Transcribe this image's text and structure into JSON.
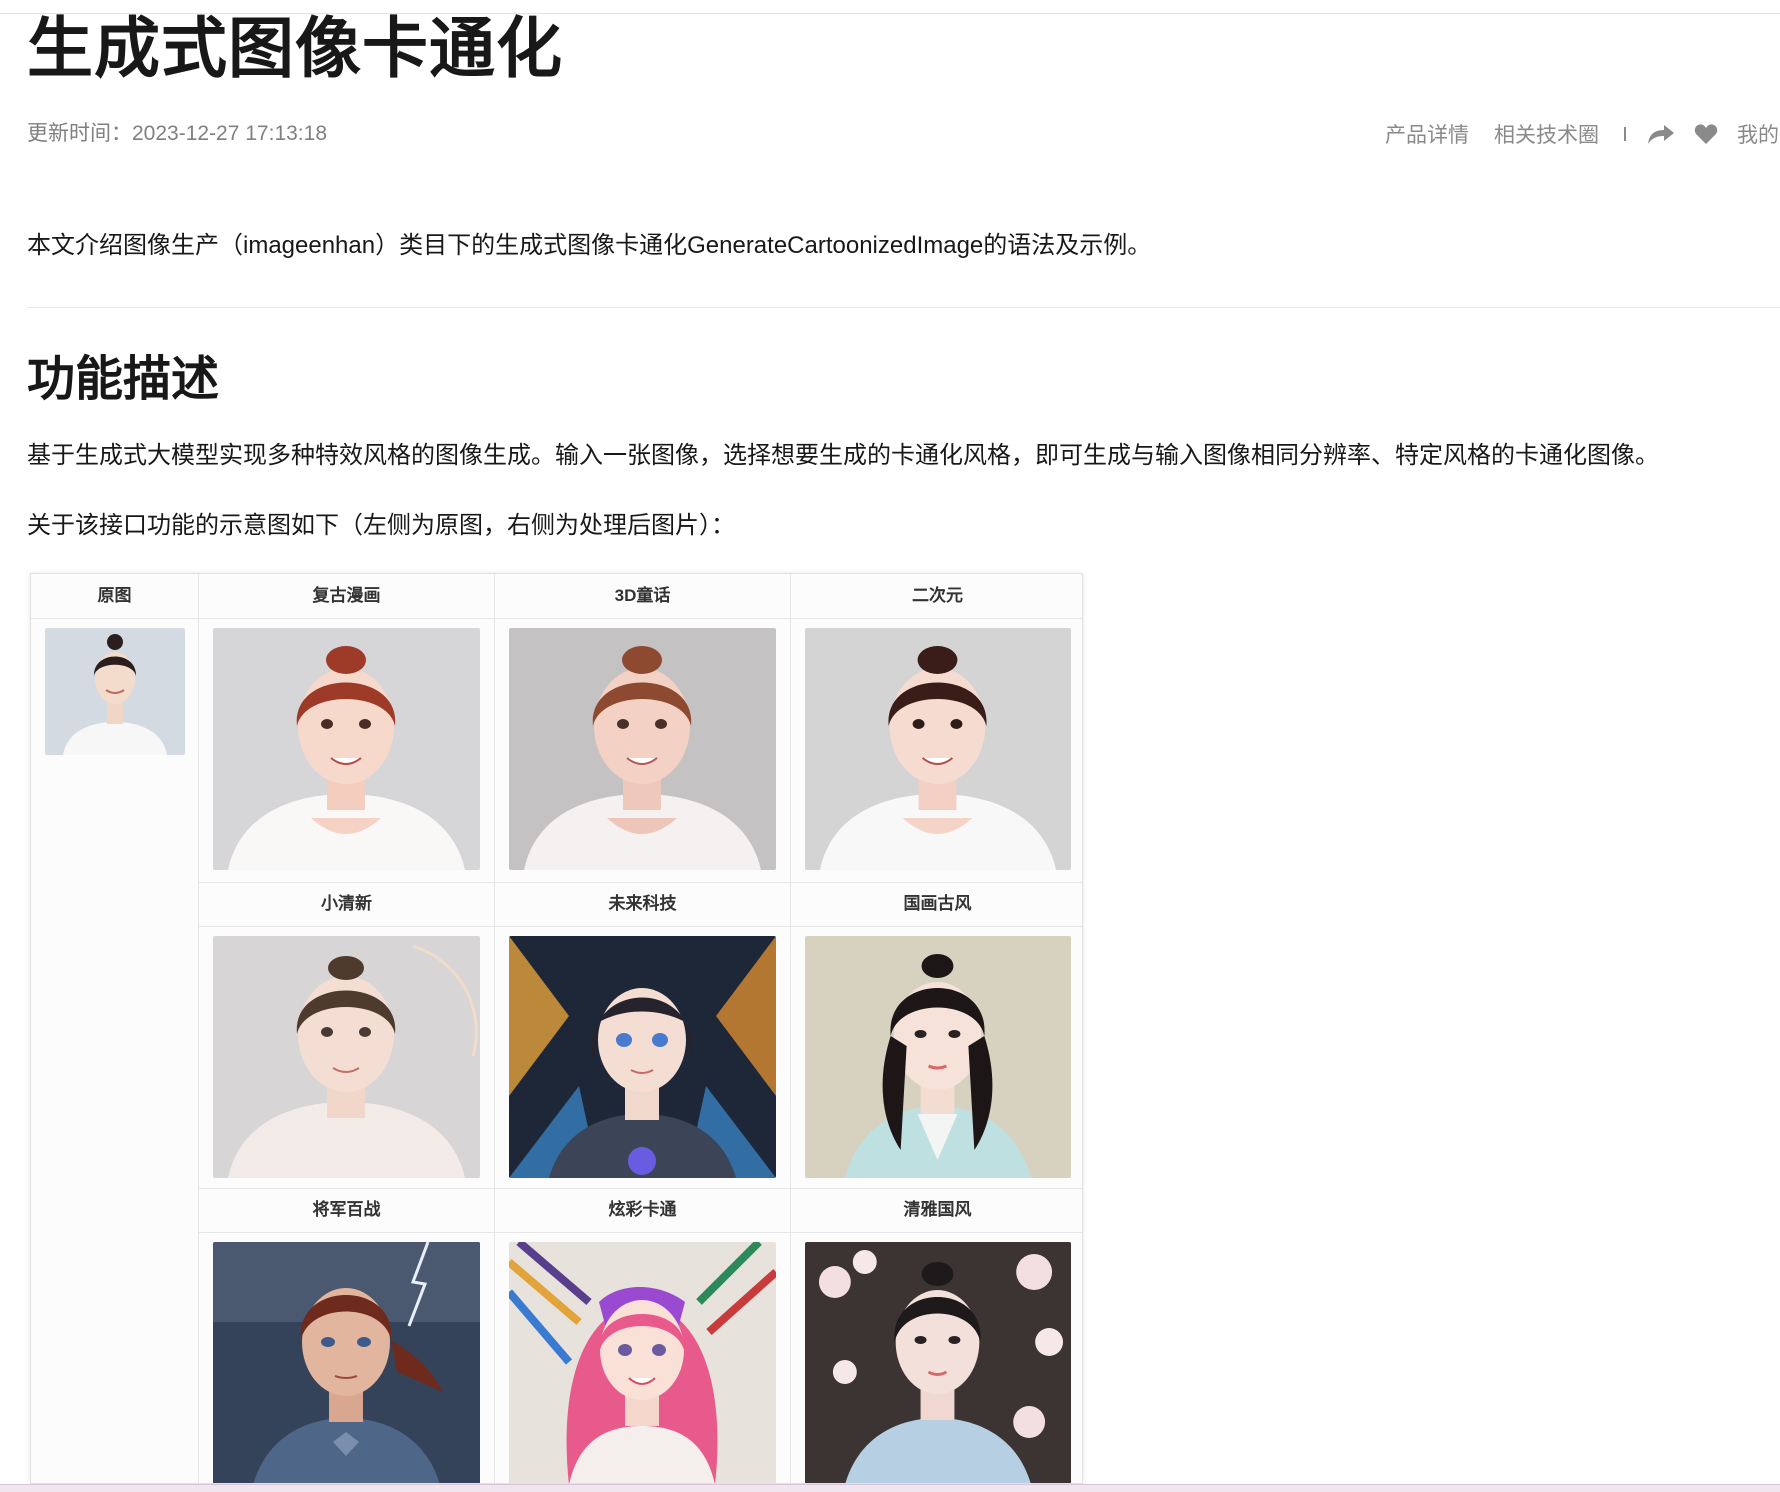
{
  "page": {
    "title": "生成式图像卡通化",
    "updated": "更新时间：2023-12-27 17:13:18",
    "intro": "本文介绍图像生产（imageenhan）类目下的生成式图像卡通化GenerateCartoonizedImage的语法及示例。"
  },
  "actions": {
    "product_details": "产品详情",
    "tech_circle": "相关技术圈",
    "my_label": "我的收",
    "share_icon": "share-icon",
    "favorite_icon": "heart-icon"
  },
  "section": {
    "title": "功能描述",
    "description": "基于生成式大模型实现多种特效风格的图像生成。输入一张图像，选择想要生成的卡通化风格，即可生成与输入图像相同分辨率、特定风格的卡通化图像。",
    "example_caption": "关于该接口功能的示意图如下（左侧为原图，右侧为处理后图片）："
  },
  "demo": {
    "original_label": "原图",
    "styles": [
      "复古漫画",
      "3D童话",
      "二次元",
      "小清新",
      "未来科技",
      "国画古风",
      "将军百战",
      "炫彩卡通",
      "清雅国风"
    ]
  },
  "colors": {
    "text": "#181818",
    "muted": "#808080",
    "divider": "#e8e8e8"
  }
}
